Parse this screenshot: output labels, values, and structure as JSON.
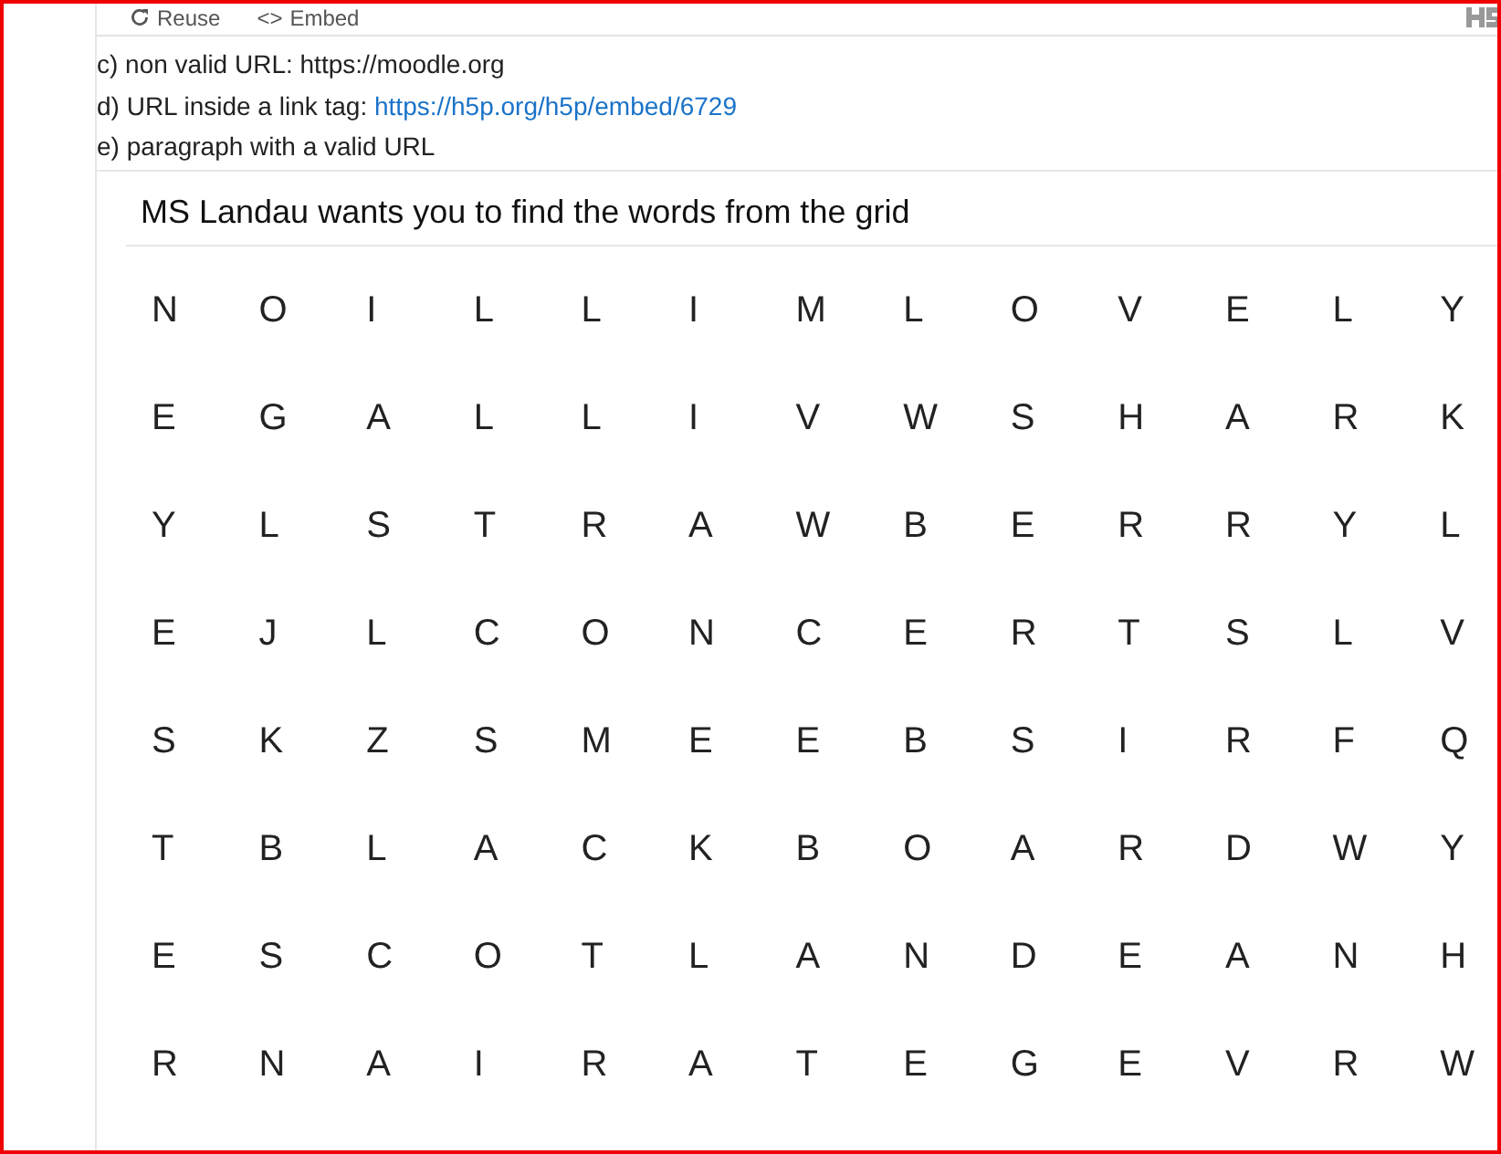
{
  "toolbar": {
    "buttons": [
      {
        "kind": "reuse",
        "label": "Reuse"
      },
      {
        "kind": "embed",
        "icon": "<>",
        "label": "Embed"
      }
    ]
  },
  "paragraphs": [
    {
      "text": "c) non valid URL: https://moodle.org"
    },
    {
      "text": "d) URL inside a link tag: ",
      "link": "https://h5p.org/h5p/embed/6729"
    },
    {
      "text": "e) paragraph with a valid URL"
    }
  ],
  "word_search": {
    "title": "MS Landau wants you to find the words from the grid",
    "grid": [
      [
        "N",
        "O",
        "I",
        "L",
        "L",
        "I",
        "M",
        "L",
        "O",
        "V",
        "E",
        "L",
        "Y"
      ],
      [
        "E",
        "G",
        "A",
        "L",
        "L",
        "I",
        "V",
        "W",
        "S",
        "H",
        "A",
        "R",
        "K"
      ],
      [
        "Y",
        "L",
        "S",
        "T",
        "R",
        "A",
        "W",
        "B",
        "E",
        "R",
        "R",
        "Y",
        "L"
      ],
      [
        "E",
        "J",
        "L",
        "C",
        "O",
        "N",
        "C",
        "E",
        "R",
        "T",
        "S",
        "L",
        "V"
      ],
      [
        "S",
        "K",
        "Z",
        "S",
        "M",
        "E",
        "E",
        "B",
        "S",
        "I",
        "R",
        "F",
        "Q"
      ],
      [
        "T",
        "B",
        "L",
        "A",
        "C",
        "K",
        "B",
        "O",
        "A",
        "R",
        "D",
        "W",
        "Y"
      ],
      [
        "E",
        "S",
        "C",
        "O",
        "T",
        "L",
        "A",
        "N",
        "D",
        "E",
        "A",
        "N",
        "H"
      ],
      [
        "R",
        "N",
        "A",
        "I",
        "R",
        "A",
        "T",
        "E",
        "G",
        "E",
        "V",
        "R",
        "W"
      ]
    ]
  }
}
